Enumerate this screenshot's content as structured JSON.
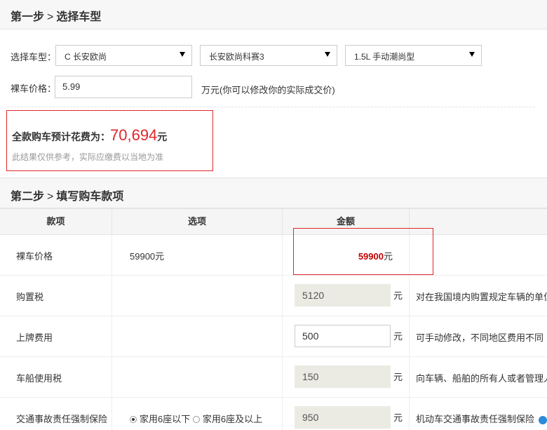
{
  "step1": {
    "title": "第一步",
    "sep": ">",
    "subtitle": "选择车型"
  },
  "car_select": {
    "label": "选择车型：",
    "brand": "C 长安欧尚",
    "series": "长安欧尚科赛3",
    "model": "1.5L 手动潮尚型"
  },
  "bare_price": {
    "label": "裸车价格：",
    "value": "5.99",
    "hint": "万元(你可以修改你的实际成交价)"
  },
  "result": {
    "label": "全款购车预计花费为：",
    "amount": "70,694",
    "unit": "元",
    "note": "此结果仅供参考，实际应缴费以当地为准"
  },
  "step2": {
    "title": "第二步",
    "sep": ">",
    "subtitle": "填写购车款项"
  },
  "table": {
    "headers": [
      "款项",
      "选项",
      "金额"
    ],
    "rows": [
      {
        "name": "裸车价格",
        "option": "59900元",
        "amount": "59900",
        "unit": "元"
      },
      {
        "name": "购置税",
        "amount": "5120",
        "unit": "元",
        "desc": "对在我国境内购置规定车辆的单位"
      },
      {
        "name": "上牌费用",
        "amount": "500",
        "unit": "元",
        "desc": "可手动修改，不同地区费用不同"
      },
      {
        "name": "车船使用税",
        "amount": "150",
        "unit": "元",
        "desc": "向车辆、船舶的所有人或者管理人"
      },
      {
        "name": "交通事故责任强制保险",
        "radio1": "家用6座以下",
        "radio2": "家用6座及以上",
        "amount": "950",
        "unit": "元",
        "desc": "机动车交通事故责任强制保险"
      }
    ]
  },
  "colors": {
    "accent_red": "#e0262a",
    "price_red": "#c00000",
    "help_blue": "#2d8ad8"
  },
  "icons": {
    "dropdown": "triangle-down-icon",
    "help": "help-circle-icon",
    "radio": "radio-icon"
  }
}
